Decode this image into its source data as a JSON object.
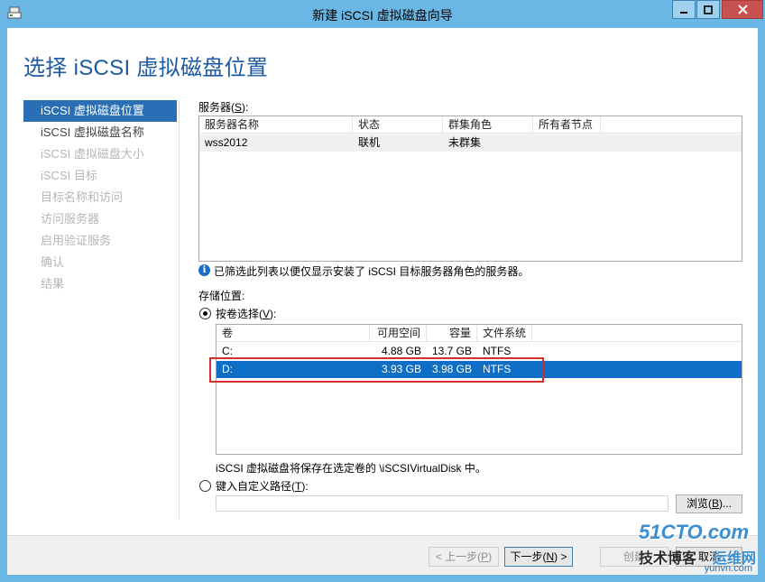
{
  "window": {
    "title": "新建 iSCSI 虚拟磁盘向导"
  },
  "page": {
    "heading": "选择 iSCSI 虚拟磁盘位置"
  },
  "nav": {
    "items": [
      {
        "label": "iSCSI 虚拟磁盘位置",
        "state": "active"
      },
      {
        "label": "iSCSI 虚拟磁盘名称",
        "state": "enabled"
      },
      {
        "label": "iSCSI 虚拟磁盘大小",
        "state": "disabled"
      },
      {
        "label": "iSCSI 目标",
        "state": "disabled"
      },
      {
        "label": "目标名称和访问",
        "state": "disabled"
      },
      {
        "label": "访问服务器",
        "state": "disabled"
      },
      {
        "label": "启用验证服务",
        "state": "disabled"
      },
      {
        "label": "确认",
        "state": "disabled"
      },
      {
        "label": "结果",
        "state": "disabled"
      }
    ]
  },
  "servers": {
    "label_prefix": "服务器(",
    "label_key": "S",
    "label_suffix": "):",
    "columns": [
      "服务器名称",
      "状态",
      "群集角色",
      "所有者节点"
    ],
    "rows": [
      {
        "name": "wss2012",
        "status": "联机",
        "role": "未群集",
        "owner": ""
      }
    ],
    "info_text": "已筛选此列表以便仅显示安装了 iSCSI 目标服务器角色的服务器。"
  },
  "storage": {
    "label": "存储位置:",
    "by_volume_prefix": "按卷选择(",
    "by_volume_key": "V",
    "by_volume_suffix": "):",
    "columns": [
      "卷",
      "可用空间",
      "容量",
      "文件系统"
    ],
    "rows": [
      {
        "volume": "C:",
        "free": "4.88 GB",
        "capacity": "13.7 GB",
        "fs": "NTFS"
      },
      {
        "volume": "D:",
        "free": "3.93 GB",
        "capacity": "3.98 GB",
        "fs": "NTFS"
      }
    ],
    "selected_index": 1,
    "save_note": "iSCSI 虚拟磁盘将保存在选定卷的 \\iSCSIVirtualDisk 中。",
    "custom_prefix": "键入自定义路径(",
    "custom_key": "T",
    "custom_suffix": "):",
    "custom_path_value": ""
  },
  "buttons": {
    "browse_prefix": "浏览(",
    "browse_key": "B",
    "browse_suffix": ")...",
    "back_prefix": "< 上一步(",
    "back_key": "P",
    "back_suffix": ")",
    "next_prefix": "下一步(",
    "next_key": "N",
    "next_suffix": ") >",
    "create": "创建",
    "cancel": "取消"
  },
  "watermark": {
    "line1": "51CTO.com",
    "line2": "技术博客",
    "line3": "运维网",
    "line4": "yunvn.com"
  },
  "colors": {
    "accent": "#2a6fb6",
    "selection": "#0f6fc6",
    "highlight_border": "#d0302b",
    "titlebar": "#6ab7e5"
  }
}
